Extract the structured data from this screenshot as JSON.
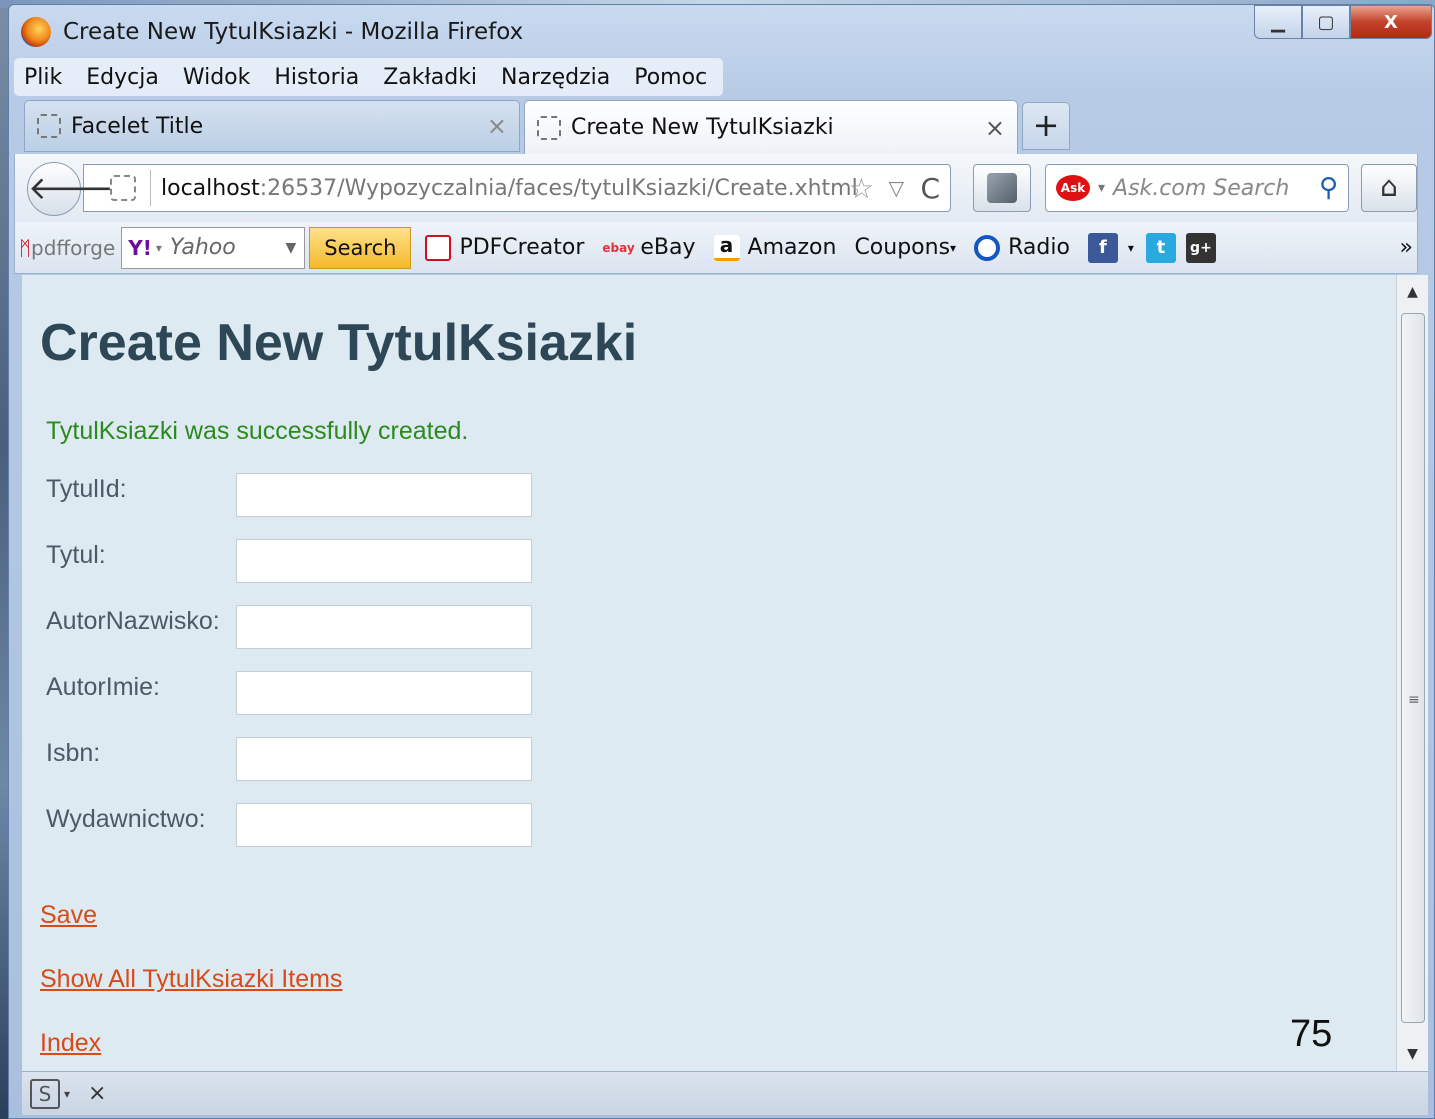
{
  "window": {
    "title": "Create New TytulKsiazki - Mozilla Firefox",
    "caption": {
      "minimize": "▁",
      "maximize": "▢",
      "close": "X"
    }
  },
  "menu": [
    "Plik",
    "Edycja",
    "Widok",
    "Historia",
    "Zakładki",
    "Narzędzia",
    "Pomoc"
  ],
  "tabs": [
    {
      "label": "Facelet Title",
      "active": false
    },
    {
      "label": "Create New TytulKsiazki",
      "active": true
    }
  ],
  "tab_close_glyph": "×",
  "newtab_glyph": "+",
  "navbar": {
    "back_glyph": "🡐",
    "url_host": "localhost",
    "url_path": ":26537/Wypozyczalnia/faces/tytulKsiazki/Create.xhtml",
    "star_glyph": "☆",
    "drop_glyph": "▽",
    "reload_glyph": "C",
    "search_placeholder": "Ask.com Search",
    "ask_logo": "Ask",
    "search_glyph": "⚲",
    "home_glyph": "⌂"
  },
  "bookmarks": {
    "pdfforge": "pdfforge",
    "yahoo_logo": "Y!",
    "yahoo_text": "Yahoo",
    "yahoo_search_button": "Search",
    "items": [
      "PDFCreator",
      "eBay",
      "Amazon",
      "Coupons",
      "Radio"
    ],
    "ebay_icon": "ebay",
    "amazon_icon": "a",
    "facebook_icon": "f",
    "twitter_icon": "t",
    "gplus_icon": "g+",
    "overflow": "»"
  },
  "page": {
    "title": "Create New TytulKsiazki",
    "success_message": "TytulKsiazki was successfully created.",
    "fields": [
      {
        "label": "TytulId:",
        "value": ""
      },
      {
        "label": "Tytul:",
        "value": ""
      },
      {
        "label": "AutorNazwisko:",
        "value": ""
      },
      {
        "label": "AutorImie:",
        "value": ""
      },
      {
        "label": "Isbn:",
        "value": ""
      },
      {
        "label": "Wydawnictwo:",
        "value": ""
      }
    ],
    "links": {
      "save": "Save",
      "show_all": "Show All TytulKsiazki Items",
      "index": "Index"
    },
    "slide_number": "75"
  },
  "addonbar": {
    "s_icon": "S",
    "close_glyph": "×"
  }
}
